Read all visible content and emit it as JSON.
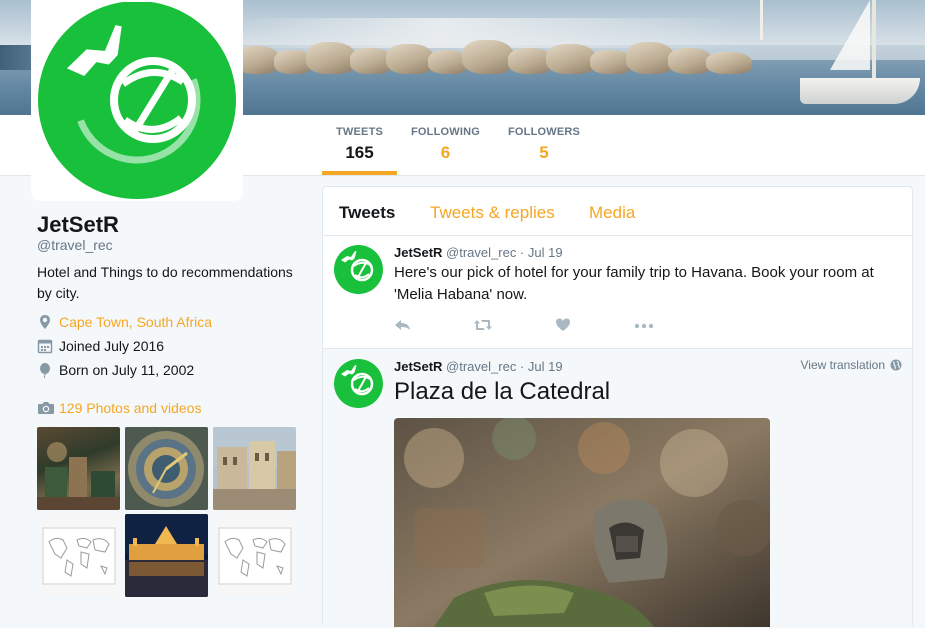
{
  "profile": {
    "name": "JetSetR",
    "handle": "@travel_rec",
    "bio": "Hotel and Things to do recommendations by city.",
    "location": "Cape Town, South Africa",
    "joined": "Joined July 2016",
    "born": "Born on July 11, 2002",
    "photos_link": "129 Photos and videos"
  },
  "nav": {
    "tweets_label": "TWEETS",
    "tweets_count": "165",
    "following_label": "FOLLOWING",
    "following_count": "6",
    "followers_label": "FOLLOWERS",
    "followers_count": "5"
  },
  "timeline": {
    "tabs": [
      "Tweets",
      "Tweets & replies",
      "Media"
    ],
    "tweets": [
      {
        "name": "JetSetR",
        "handle_date": "@travel_rec · Jul 19",
        "text": "Here's our pick of hotel for your family trip to Havana. Book your room at 'Melia Habana' now."
      },
      {
        "name": "JetSetR",
        "handle_date": "@travel_rec · Jul 19",
        "title": "Plaza de la Catedral",
        "view_translation": "View translation"
      }
    ]
  },
  "colors": {
    "accent": "#f5a623",
    "brand_green": "#19c03c",
    "text": "#14171a",
    "muted": "#657786"
  },
  "icons": [
    "location-pin-icon",
    "calendar-icon",
    "balloon-icon",
    "camera-icon",
    "reply-icon",
    "retweet-icon",
    "like-icon",
    "more-icon",
    "globe-icon",
    "plane-globe-logo"
  ]
}
